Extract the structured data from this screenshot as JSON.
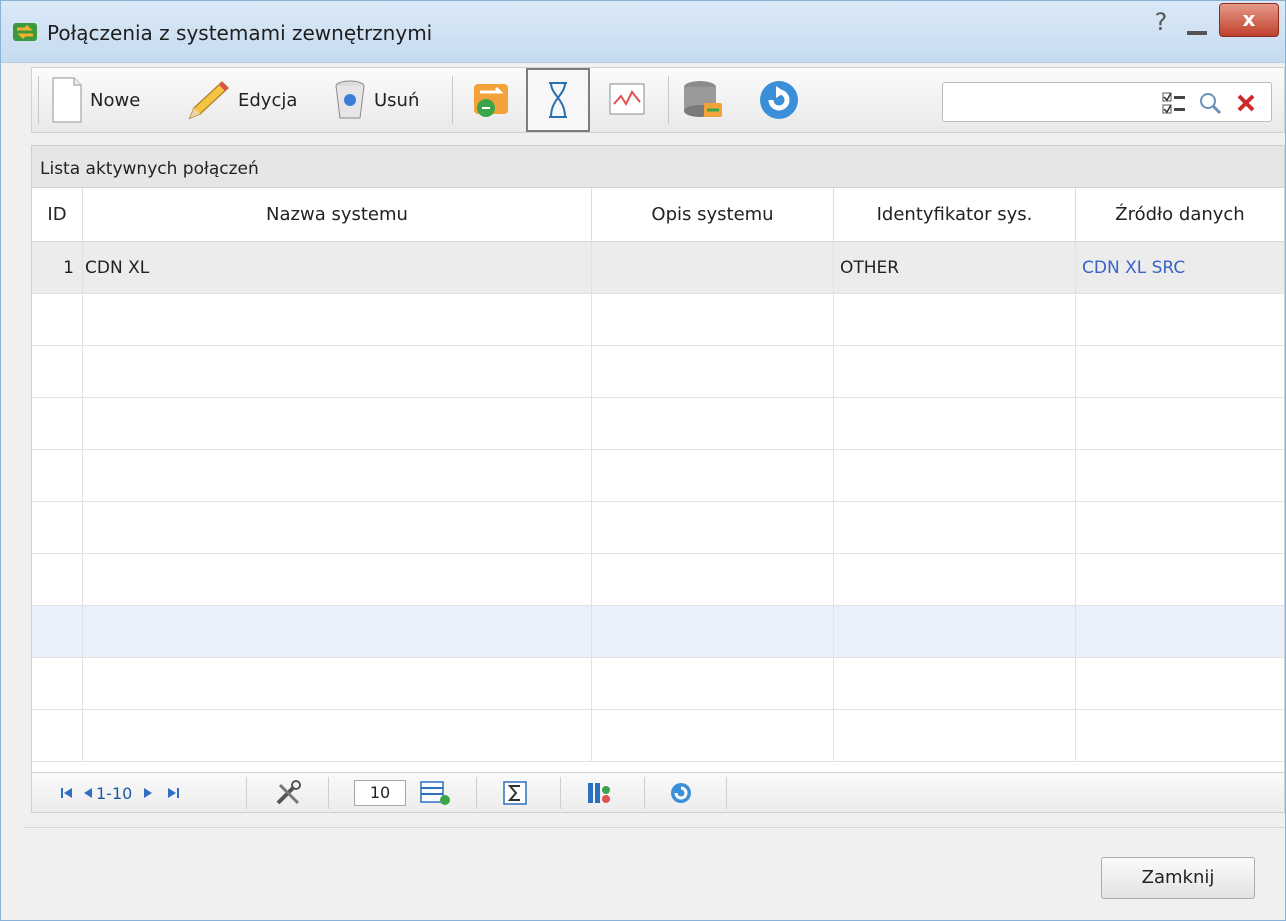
{
  "window": {
    "title": "Połączenia z systemami zewnętrznymi",
    "help_symbol": "?",
    "close_symbol": "x"
  },
  "toolbar": {
    "new_label": "Nowe",
    "edit_label": "Edycja",
    "delete_label": "Usuń",
    "search_placeholder": ""
  },
  "panel": {
    "title": "Lista aktywnych połączeń"
  },
  "table": {
    "columns": [
      "ID",
      "Nazwa systemu",
      "Opis systemu",
      "Identyfikator sys.",
      "Źródło danych"
    ],
    "rows": [
      {
        "id": "1",
        "name": "CDN XL",
        "description": "",
        "identifier": "OTHER",
        "source": "CDN XL SRC"
      }
    ]
  },
  "pager": {
    "range": "1-10",
    "page_size": "10"
  },
  "footer": {
    "close_label": "Zamknij"
  },
  "colors": {
    "link": "#3a63c8",
    "title_bar": "#c6dbf0",
    "close_button": "#c0412d"
  }
}
